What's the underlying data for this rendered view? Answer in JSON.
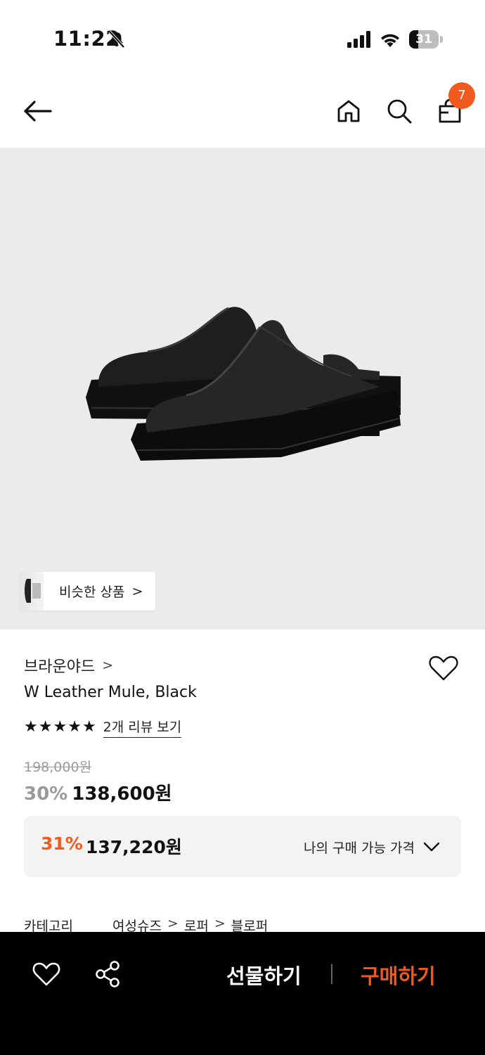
{
  "status_bar": {
    "time": "11:22",
    "battery_level": "31",
    "icons": [
      "bell-slash-icon",
      "signal-icon",
      "wifi-icon",
      "battery-icon"
    ]
  },
  "top_nav": {
    "icons": [
      "arrow-left-icon",
      "home-icon",
      "search-icon",
      "shopping-bag-icon"
    ],
    "cart_count": "7"
  },
  "product_image": {
    "similar_label": "비슷한 상품",
    "similar_chevron": ">"
  },
  "product": {
    "brand": "브라운야드",
    "brand_chevron": ">",
    "name": "W Leather Mule, Black",
    "rating_stars": 5,
    "review_link": "2개 리뷰 보기",
    "original_price": "198,000원",
    "discount_rate": "30%",
    "sale_price": "138,600원"
  },
  "member_price": {
    "discount_rate": "31%",
    "price": "137,220원",
    "label": "나의 구매 가능 가격"
  },
  "category": {
    "label": "카테고리",
    "path": [
      "여성슈즈",
      "로퍼",
      "블로퍼"
    ],
    "separator": ">"
  },
  "bottom_bar": {
    "gift_label": "선물하기",
    "buy_label": "구매하기",
    "icons": [
      "heart-icon",
      "share-icon"
    ]
  },
  "colors": {
    "accent": "#f05a1e",
    "image_background": "#ebebeb",
    "bottom_bar": "#000000",
    "price_box": "#f3f3f3"
  }
}
